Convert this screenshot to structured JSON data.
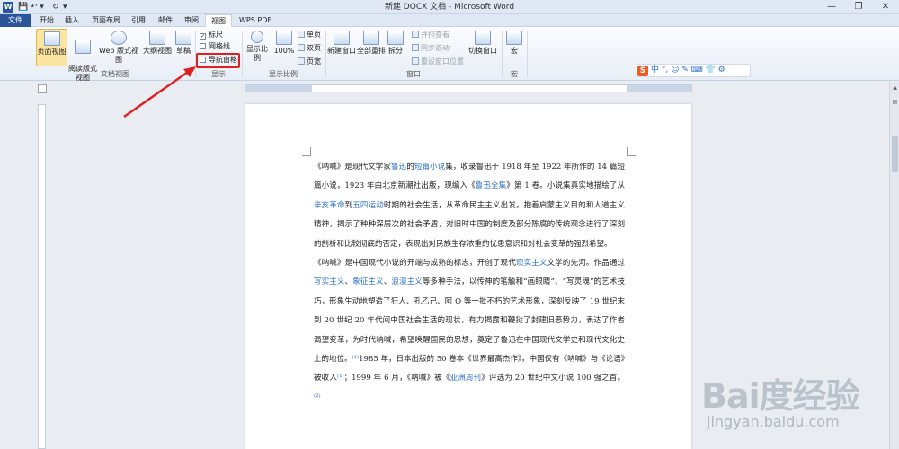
{
  "titlebar": {
    "app_icon": "W",
    "quick_access": [
      "💾",
      "↶ ▾",
      "↻",
      "▾"
    ],
    "title": "新建 DOCX 文档 - Microsoft Word",
    "window_buttons": [
      "—",
      "❐",
      "✕"
    ]
  },
  "tabs": [
    "文件",
    "开始",
    "插入",
    "页面布局",
    "引用",
    "邮件",
    "审阅",
    "视图",
    "WPS PDF"
  ],
  "active_tab": "视图",
  "ribbon": {
    "document_views": {
      "label": "文档视图",
      "buttons": [
        "页面视图",
        "阅读版式\n视图",
        "Web 版式视图",
        "大纲视图",
        "草稿"
      ]
    },
    "show": {
      "label": "显示",
      "checks": [
        {
          "label": "标尺",
          "checked": true
        },
        {
          "label": "网格线",
          "checked": false
        },
        {
          "label": "导航窗格",
          "checked": false
        }
      ]
    },
    "zoom": {
      "label": "显示比例",
      "buttons": [
        "显示比例",
        "100%"
      ],
      "small": [
        "单页",
        "双页",
        "页宽"
      ]
    },
    "window": {
      "label": "窗口",
      "buttons": [
        "新建窗口",
        "全部重排",
        "拆分"
      ],
      "small": [
        "并排查看",
        "同步滚动",
        "重设窗口位置"
      ],
      "switch": "切换窗口"
    },
    "macro": {
      "label": "宏",
      "buttons": [
        "宏"
      ]
    }
  },
  "ime": {
    "logo": "S",
    "items": "中 °, ☺ ✎ ⌨ 👕 ⚙"
  },
  "document": {
    "paragraph1": [
      {
        "t": "《呐喊》是现代文学家"
      },
      {
        "t": "鲁迅",
        "link": true
      },
      {
        "t": "的"
      },
      {
        "t": "短篇小说",
        "link": true
      },
      {
        "t": "集，收录鲁迅于 1918 年至 1922 年所作的 14 篇短篇小说，1923 年由北京新潮社出版，现编入《"
      },
      {
        "t": "鲁迅全集",
        "link": true
      },
      {
        "t": "》第 1 卷。小说"
      },
      {
        "t": "集真实",
        "u": true
      },
      {
        "t": "地描绘了从"
      },
      {
        "t": "辛亥革命",
        "link": true
      },
      {
        "t": "到"
      },
      {
        "t": "五四运动",
        "link": true
      },
      {
        "t": "时期的社会生活，从革命民主主义出发，抱着启蒙主义目的和人道主义精神，揭示了种种深层次的社会矛盾，对旧时中国的制度及部分陈腐的传统观念进行了深刻的剖析和比较彻底的否定，表现出对民族生存浓重的忧患意识和对社会变革的强烈希望。"
      }
    ],
    "paragraph2": [
      {
        "t": "《呐喊》是中国现代小说的开端与成熟的标志，开创了现代"
      },
      {
        "t": "现实主义",
        "link": true
      },
      {
        "t": "文学的先河。作品通过"
      },
      {
        "t": "写实主义",
        "link": true
      },
      {
        "t": "、"
      },
      {
        "t": "象征主义",
        "link": true
      },
      {
        "t": "、"
      },
      {
        "t": "浪漫主义",
        "link": true
      },
      {
        "t": "等多种手法，以传神的笔触和“画眼睛”、“写灵魂”的艺术技巧，形象生动地塑造了狂人、孔乙己、阿 Q 等一批不朽的艺术形象，深刻反映了 19 世纪末到 20 世纪 20 年代间中国社会生活的现状，有力揭露和鞭挞了封建旧恶势力，表达了作者渴望变革，为时代呐喊，希望唤醒国民的思想，奠定了鲁迅在中国现代文学史和现代文化史上的地位。"
      },
      {
        "t": "⁽¹⁾",
        "link": true
      },
      {
        "t": "1985 年，日本出版的 50 卷本《世界最高杰作》，中国仅有《呐喊》与《论语》被收入"
      },
      {
        "t": "⁽¹⁾",
        "link": true
      },
      {
        "t": "；1999 年 6 月，《呐喊》被《"
      },
      {
        "t": "亚洲周刊",
        "link": true
      },
      {
        "t": "》评选为 20 世纪中文小说 100 强之首。"
      },
      {
        "t": "⁽²⁾",
        "link": true
      }
    ]
  },
  "watermark": {
    "logo": "Bai度经验",
    "url": "jingyan.baidu.com"
  },
  "colors": {
    "accent": "#2a5699",
    "link": "#2a6fc9",
    "highlight": "#e02020"
  }
}
